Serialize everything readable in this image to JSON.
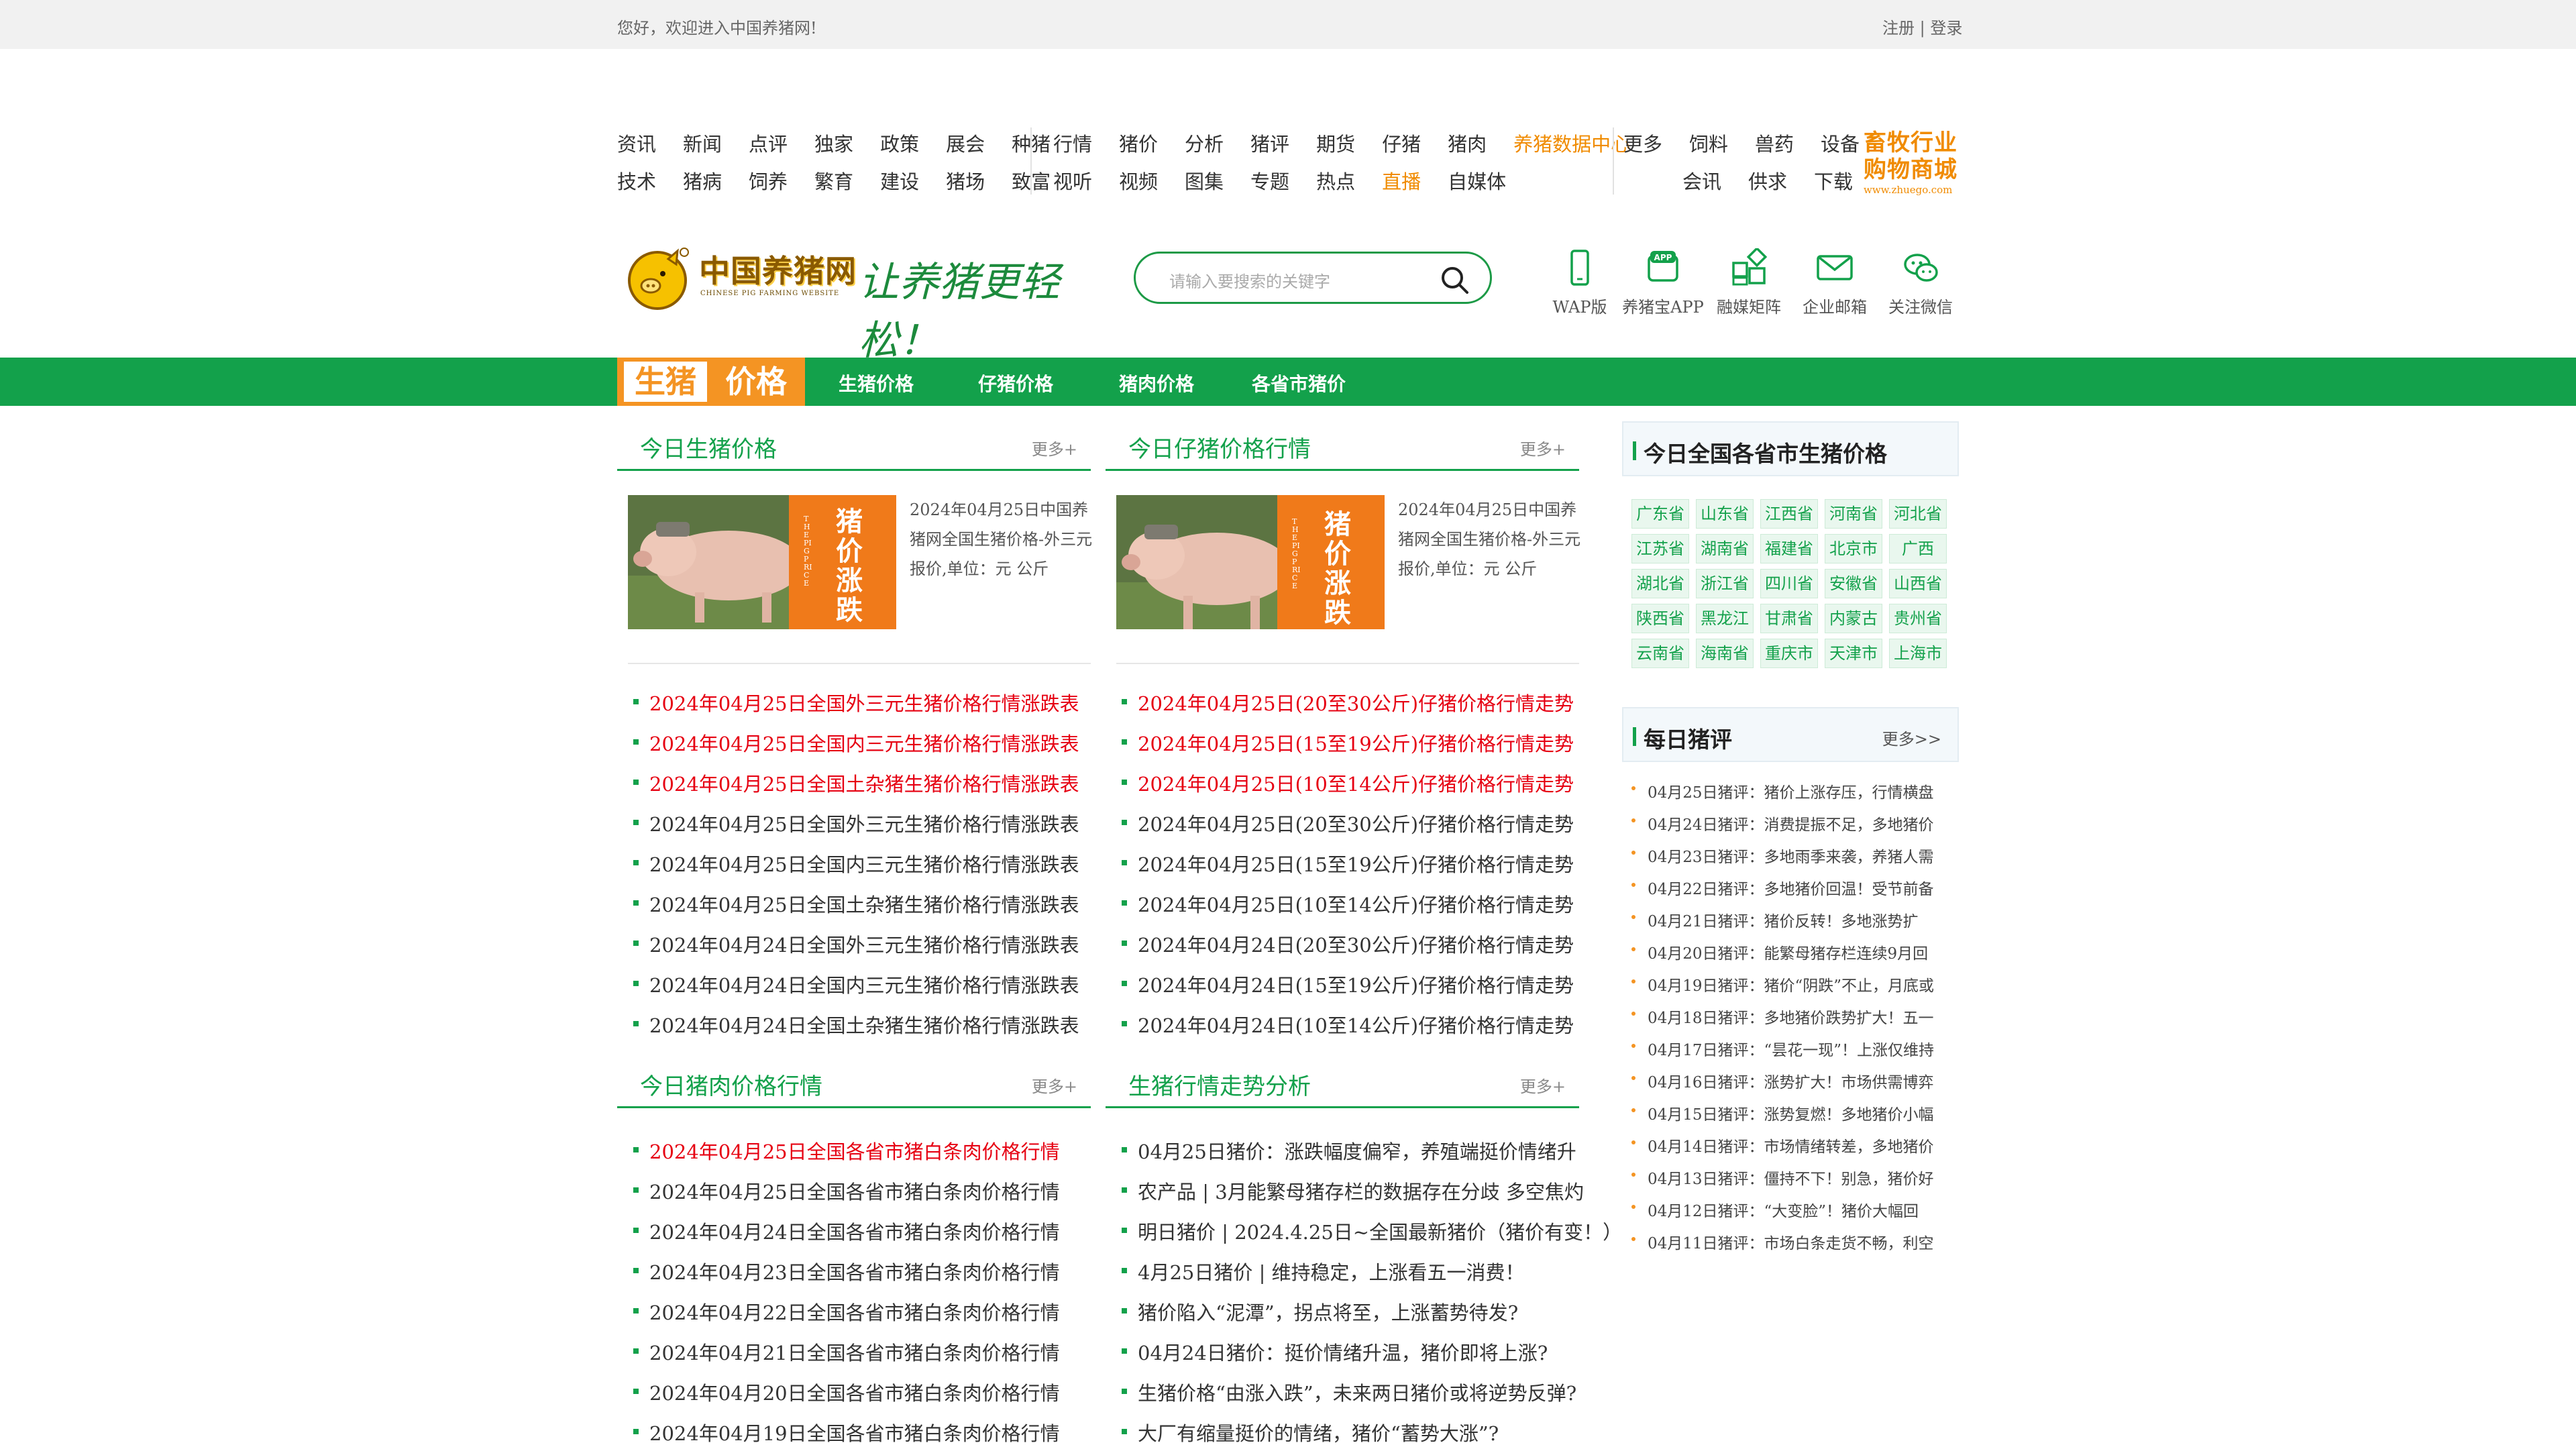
{
  "topbar": {
    "welcome": "您好，欢迎进入中国养猪网!",
    "register": "注册",
    "sep": " | ",
    "login": "登录"
  },
  "nav": {
    "group1": {
      "row1": [
        "资讯",
        "新闻",
        "点评",
        "独家",
        "政策",
        "展会",
        "种猪"
      ],
      "row2": [
        "技术",
        "猪病",
        "饲养",
        "繁育",
        "建设",
        "猪场",
        "致富"
      ]
    },
    "group2": {
      "row1": [
        "行情",
        "猪价",
        "分析",
        "猪评",
        "期货",
        "仔猪",
        "猪肉"
      ],
      "row1_highlight": "养猪数据中心",
      "row2": [
        "视听",
        "视频",
        "图集",
        "专题",
        "热点"
      ],
      "row2_highlight": "直播",
      "row2_tail": "自媒体"
    },
    "group3": {
      "row1": [
        "更多",
        "饲料",
        "兽药",
        "设备"
      ],
      "row2": [
        "会讯",
        "供求",
        "下载"
      ]
    },
    "mall": {
      "line1": "畜牧行业",
      "line2": "购物商城",
      "url": "www.zhuego.com"
    }
  },
  "logo": {
    "cn": "中国养猪网",
    "en": "CHINESE PIG FARMING WEBSITE",
    "slogan": "让养猪更轻松！"
  },
  "search": {
    "placeholder": "请输入要搜索的关键字"
  },
  "tools": [
    {
      "label": "WAP版",
      "icon": "phone-icon"
    },
    {
      "label": "养猪宝APP",
      "icon": "app-icon"
    },
    {
      "label": "融媒矩阵",
      "icon": "grid-icon"
    },
    {
      "label": "企业邮箱",
      "icon": "mail-icon"
    },
    {
      "label": "关注微信",
      "icon": "wechat-icon"
    }
  ],
  "price_bar": {
    "badge_left": "生猪",
    "badge_right": "价格",
    "menu": [
      "生猪价格",
      "仔猪价格",
      "猪肉价格",
      "各省市猪价"
    ]
  },
  "col1": {
    "title": "今日生猪价格",
    "more": "更多+",
    "image_text": "猪价涨跌",
    "image_subtext": "THE PIG PRICE",
    "summary": "2024年04月25日中国养猪网全国生猪价格-外三元报价,单位：元 公斤",
    "items": [
      "2024年04月25日全国外三元生猪价格行情涨跌表",
      "2024年04月25日全国内三元生猪价格行情涨跌表",
      "2024年04月25日全国土杂猪生猪价格行情涨跌表",
      "2024年04月25日全国外三元生猪价格行情涨跌表",
      "2024年04月25日全国内三元生猪价格行情涨跌表",
      "2024年04月25日全国土杂猪生猪价格行情涨跌表",
      "2024年04月24日全国外三元生猪价格行情涨跌表",
      "2024年04月24日全国内三元生猪价格行情涨跌表",
      "2024年04月24日全国土杂猪生猪价格行情涨跌表"
    ]
  },
  "col2": {
    "title": "今日仔猪价格行情",
    "more": "更多+",
    "image_text": "猪价涨跌",
    "image_subtext": "THE PIG PRICE",
    "summary": "2024年04月25日中国养猪网全国生猪价格-外三元报价,单位：元 公斤",
    "items": [
      "2024年04月25日(20至30公斤)仔猪价格行情走势",
      "2024年04月25日(15至19公斤)仔猪价格行情走势",
      "2024年04月25日(10至14公斤)仔猪价格行情走势",
      "2024年04月25日(20至30公斤)仔猪价格行情走势",
      "2024年04月25日(15至19公斤)仔猪价格行情走势",
      "2024年04月25日(10至14公斤)仔猪价格行情走势",
      "2024年04月24日(20至30公斤)仔猪价格行情走势",
      "2024年04月24日(15至19公斤)仔猪价格行情走势",
      "2024年04月24日(10至14公斤)仔猪价格行情走势"
    ]
  },
  "col3": {
    "title": "今日猪肉价格行情",
    "more": "更多+",
    "items": [
      "2024年04月25日全国各省市猪白条肉价格行情",
      "2024年04月25日全国各省市猪白条肉价格行情",
      "2024年04月24日全国各省市猪白条肉价格行情",
      "2024年04月23日全国各省市猪白条肉价格行情",
      "2024年04月22日全国各省市猪白条肉价格行情",
      "2024年04月21日全国各省市猪白条肉价格行情",
      "2024年04月20日全国各省市猪白条肉价格行情",
      "2024年04月19日全国各省市猪白条肉价格行情"
    ]
  },
  "col4": {
    "title": "生猪行情走势分析",
    "more": "更多+",
    "items": [
      "04月25日猪价：涨跌幅度偏窄，养殖端挺价情绪升",
      "农产品 | 3月能繁母猪存栏的数据存在分歧 多空焦灼",
      "明日猪价 | 2024.4.25日~全国最新猪价（猪价有变！）",
      "4月25日猪价 | 维持稳定，上涨看五一消费！",
      "猪价陷入“泥潭”，拐点将至，上涨蓄势待发?",
      "04月24日猪价：挺价情绪升温，猪价即将上涨?",
      "生猪价格“由涨入跌”，未来两日猪价或将逆势反弹?",
      "大厂有缩量挺价的情绪，猪价“蓄势大涨”?"
    ]
  },
  "sidebar": {
    "provinces_title": "今日全国各省市生猪价格",
    "provinces": [
      "广东省",
      "山东省",
      "江西省",
      "河南省",
      "河北省",
      "江苏省",
      "湖南省",
      "福建省",
      "北京市",
      "广西",
      "湖北省",
      "浙江省",
      "四川省",
      "安徽省",
      "山西省",
      "陕西省",
      "黑龙江",
      "甘肃省",
      "内蒙古",
      "贵州省",
      "云南省",
      "海南省",
      "重庆市",
      "天津市",
      "上海市"
    ],
    "comment_title": "每日猪评",
    "comment_more": "更多>>",
    "comments": [
      "04月25日猪评：猪价上涨存压，行情横盘",
      "04月24日猪评：消费提振不足，多地猪价",
      "04月23日猪评：多地雨季来袭，养猪人需",
      "04月22日猪评：多地猪价回温！受节前备",
      "04月21日猪评：猪价反转！多地涨势扩",
      "04月20日猪评：能繁母猪存栏连续9月回",
      "04月19日猪评：猪价“阴跌”不止，月底或",
      "04月18日猪评：多地猪价跌势扩大！五一",
      "04月17日猪评：“昙花一现”！上涨仅维持",
      "04月16日猪评：涨势扩大！市场供需博弈",
      "04月15日猪评：涨势复燃！多地猪价小幅",
      "04月14日猪评：市场情绪转差，多地猪价",
      "04月13日猪评：僵持不下！别急，猪价好",
      "04月12日猪评：“大变脸”！猪价大幅回",
      "04月11日猪评：市场白条走货不畅，利空"
    ]
  },
  "colors": {
    "green": "#13a14b",
    "orange": "#f49423",
    "red": "#e60012"
  }
}
